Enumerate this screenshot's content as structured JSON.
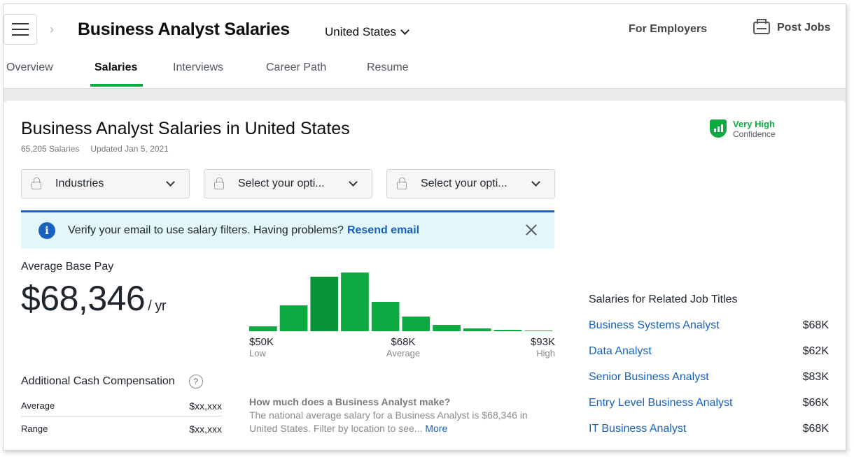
{
  "header": {
    "title": "Business Analyst Salaries",
    "country": "United States",
    "for_employers": "For Employers",
    "post_jobs": "Post Jobs"
  },
  "tabs": [
    {
      "label": "Overview",
      "active": false
    },
    {
      "label": "Salaries",
      "active": true
    },
    {
      "label": "Interviews",
      "active": false
    },
    {
      "label": "Career Path",
      "active": false
    },
    {
      "label": "Resume",
      "active": false
    }
  ],
  "card": {
    "title": "Business Analyst Salaries in United States",
    "salaries_count": "65,205 Salaries",
    "updated": "Updated Jan 5, 2021",
    "confidence_level": "Very High",
    "confidence_label": "Confidence"
  },
  "filters": [
    {
      "label": "Industries",
      "icon": "lock-icon"
    },
    {
      "label": "Select your opti...",
      "icon": "lock-icon"
    },
    {
      "label": "Select your opti...",
      "icon": "lock-icon"
    }
  ],
  "alert": {
    "text": "Verify your email to use salary filters. Having problems?",
    "link": "Resend email"
  },
  "pay": {
    "label": "Average Base Pay",
    "amount": "$68,346",
    "unit": "/ yr"
  },
  "chart_data": {
    "type": "bar",
    "values": [
      7,
      37,
      78,
      84,
      42,
      21,
      9,
      4,
      2,
      1
    ],
    "highlight_index": 2,
    "axis": [
      {
        "value": "$50K",
        "label": "Low"
      },
      {
        "value": "$68K",
        "label": "Average"
      },
      {
        "value": "$93K",
        "label": "High"
      }
    ],
    "colors": {
      "bar": "#0caa41",
      "highlight": "#0a9438"
    }
  },
  "additional": {
    "title": "Additional Cash Compensation",
    "rows": [
      {
        "key": "Average",
        "value": "$xx,xxx"
      },
      {
        "key": "Range",
        "value": "$xx,xxx"
      }
    ]
  },
  "faq": {
    "question": "How much does a Business Analyst make?",
    "answer": "The national average salary for a Business Analyst is $68,346 in United States. Filter by location to see...",
    "more": "More"
  },
  "related": {
    "title": "Salaries for Related Job Titles",
    "items": [
      {
        "title": "Business Systems Analyst",
        "pay": "$68K"
      },
      {
        "title": "Data Analyst",
        "pay": "$62K"
      },
      {
        "title": "Senior Business Analyst",
        "pay": "$83K"
      },
      {
        "title": "Entry Level Business Analyst",
        "pay": "$66K"
      },
      {
        "title": "IT Business Analyst",
        "pay": "$68K"
      }
    ]
  }
}
